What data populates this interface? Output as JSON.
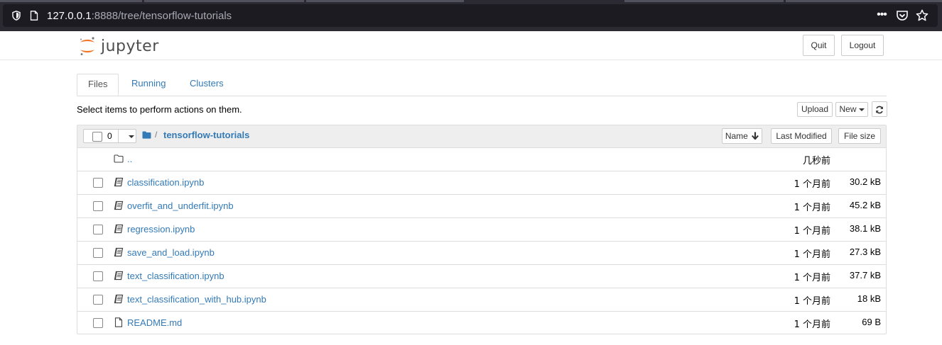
{
  "browser": {
    "url_host": "127.0.0.1",
    "url_rest": ":8888/tree/tensorflow-tutorials",
    "icons": [
      "shield-icon",
      "page-icon",
      "more-icon",
      "pocket-icon",
      "bookmark-star-icon"
    ]
  },
  "header": {
    "logo_text": "jupyter",
    "quit_label": "Quit",
    "logout_label": "Logout"
  },
  "tabs": [
    {
      "label": "Files"
    },
    {
      "label": "Running"
    },
    {
      "label": "Clusters"
    }
  ],
  "toolbar": {
    "helper_text": "Select items to perform actions on them.",
    "upload_label": "Upload",
    "new_label": "New"
  },
  "list": {
    "selected_count": "0",
    "breadcrumb_sep": "/",
    "current_dir": "tensorflow-tutorials",
    "sort_name_label": "Name",
    "sort_modified_label": "Last Modified",
    "sort_size_label": "File size",
    "parent": {
      "name": "..",
      "modified": "几秒前"
    },
    "items": [
      {
        "name": "classification.ipynb",
        "type": "notebook",
        "modified": "1 个月前",
        "size": "30.2 kB"
      },
      {
        "name": "overfit_and_underfit.ipynb",
        "type": "notebook",
        "modified": "1 个月前",
        "size": "45.2 kB"
      },
      {
        "name": "regression.ipynb",
        "type": "notebook",
        "modified": "1 个月前",
        "size": "38.1 kB"
      },
      {
        "name": "save_and_load.ipynb",
        "type": "notebook",
        "modified": "1 个月前",
        "size": "27.3 kB"
      },
      {
        "name": "text_classification.ipynb",
        "type": "notebook",
        "modified": "1 个月前",
        "size": "37.7 kB"
      },
      {
        "name": "text_classification_with_hub.ipynb",
        "type": "notebook",
        "modified": "1 个月前",
        "size": "18 kB"
      },
      {
        "name": "README.md",
        "type": "file",
        "modified": "1 个月前",
        "size": "69 B"
      }
    ]
  },
  "colors": {
    "link": "#337ab7",
    "logo_orange": "#f37626",
    "chrome_bg": "#2b2a33"
  }
}
